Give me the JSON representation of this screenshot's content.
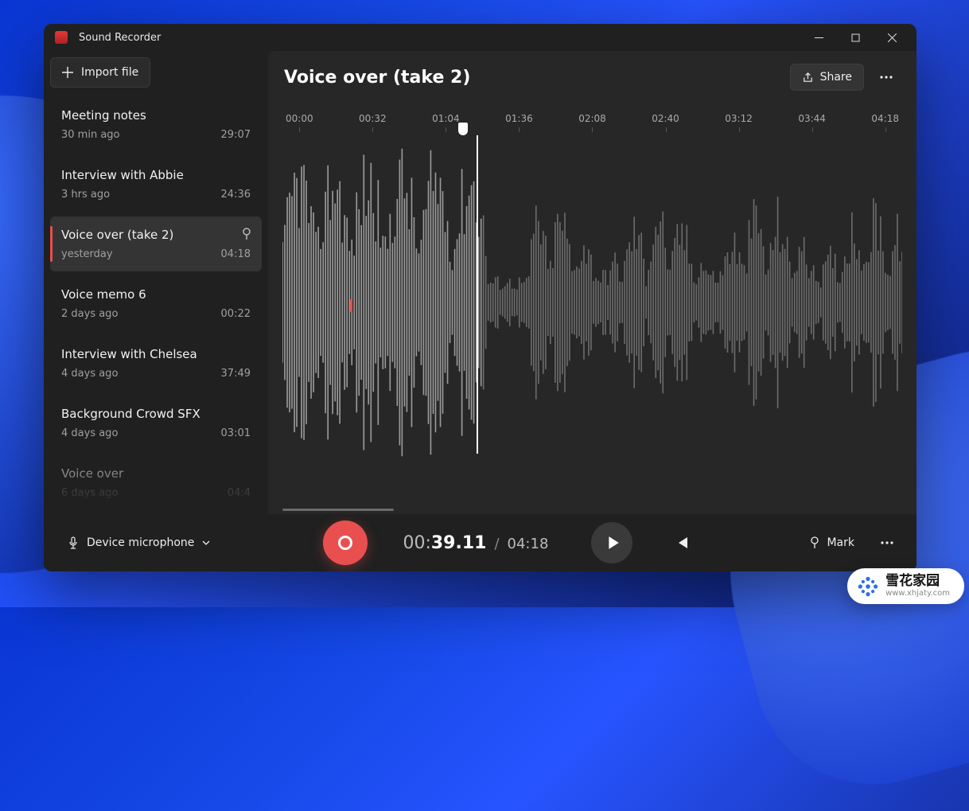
{
  "app": {
    "title": "Sound Recorder"
  },
  "sidebar": {
    "import_label": "Import file",
    "items": [
      {
        "name": "Meeting notes",
        "ago": "30 min ago",
        "duration": "29:07"
      },
      {
        "name": "Interview with Abbie",
        "ago": "3 hrs ago",
        "duration": "24:36"
      },
      {
        "name": "Voice over (take 2)",
        "ago": "yesterday",
        "duration": "04:18",
        "selected": true,
        "has_marker": true
      },
      {
        "name": "Voice memo 6",
        "ago": "2 days ago",
        "duration": "00:22"
      },
      {
        "name": "Interview with Chelsea",
        "ago": "4 days ago",
        "duration": "37:49"
      },
      {
        "name": "Background Crowd SFX",
        "ago": "4 days ago",
        "duration": "03:01"
      },
      {
        "name": "Voice over",
        "ago": "6 days ago",
        "duration": "04:4"
      }
    ]
  },
  "main": {
    "title": "Voice over (take 2)",
    "share_label": "Share",
    "ruler": [
      "00:00",
      "00:32",
      "01:04",
      "01:36",
      "02:08",
      "02:40",
      "03:12",
      "03:44",
      "04:18"
    ]
  },
  "playback": {
    "current_prefix": "00:",
    "current": "39.11",
    "separator": "/",
    "duration": "04:18"
  },
  "bottom": {
    "device_label": "Device microphone",
    "mark_label": "Mark"
  },
  "watermark": {
    "line1": "雪花家园",
    "line2": "www.xhjaty.com"
  }
}
